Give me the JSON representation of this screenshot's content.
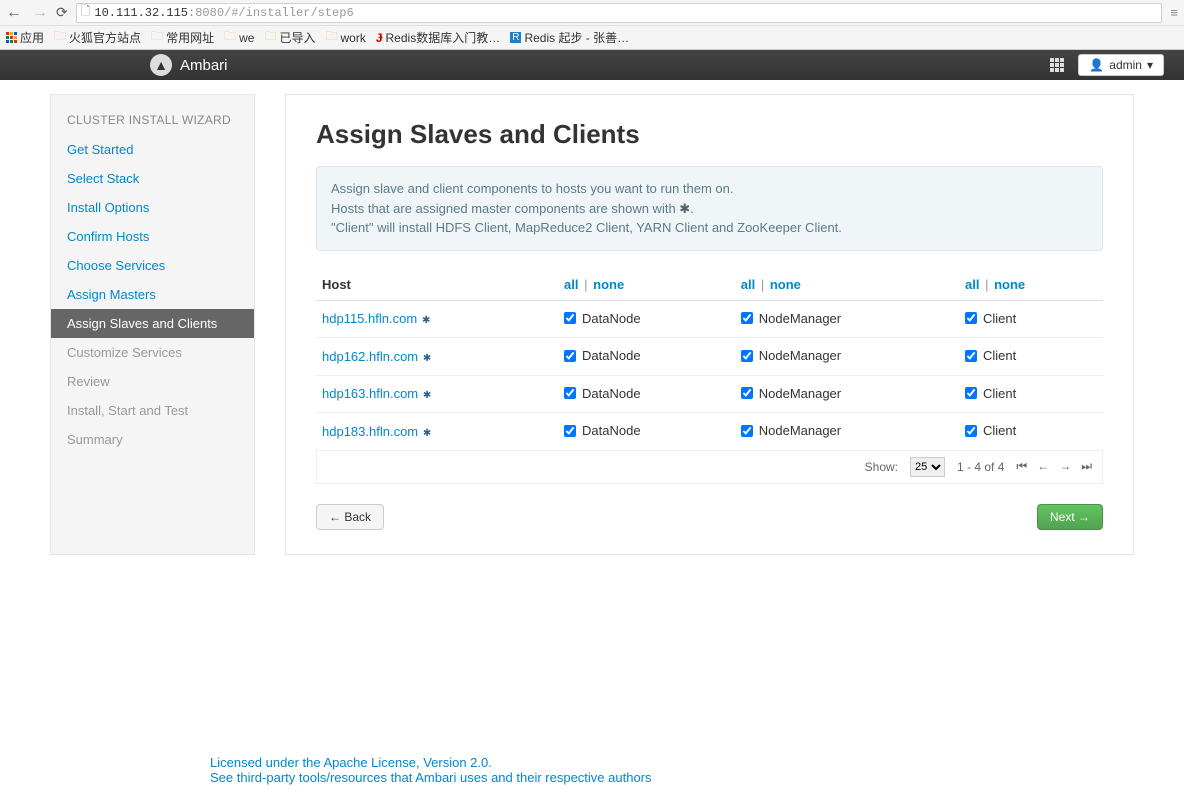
{
  "browser": {
    "url_host": "10.111.32.115",
    "url_port": ":8080",
    "url_path": "/#/installer/step6"
  },
  "bookmarks": {
    "apps": "应用",
    "items": [
      "火狐官方站点",
      "常用网址",
      "we",
      "已导入",
      "work",
      "Redis数据库入门教…",
      "Redis 起步 - 张善…"
    ]
  },
  "header": {
    "brand": "Ambari",
    "admin": "admin"
  },
  "wizard": {
    "title": "CLUSTER INSTALL WIZARD",
    "steps": [
      {
        "label": "Get Started",
        "state": "done"
      },
      {
        "label": "Select Stack",
        "state": "done"
      },
      {
        "label": "Install Options",
        "state": "done"
      },
      {
        "label": "Confirm Hosts",
        "state": "done"
      },
      {
        "label": "Choose Services",
        "state": "done"
      },
      {
        "label": "Assign Masters",
        "state": "done"
      },
      {
        "label": "Assign Slaves and Clients",
        "state": "active"
      },
      {
        "label": "Customize Services",
        "state": "future"
      },
      {
        "label": "Review",
        "state": "future"
      },
      {
        "label": "Install, Start and Test",
        "state": "future"
      },
      {
        "label": "Summary",
        "state": "future"
      }
    ]
  },
  "main": {
    "title": "Assign Slaves and Clients",
    "info_l1": "Assign slave and client components to hosts you want to run them on.",
    "info_l2a": "Hosts that are assigned master components are shown with ",
    "info_l2b": ".",
    "info_l3": "\"Client\" will install HDFS Client, MapReduce2 Client, YARN Client and ZooKeeper Client.",
    "columns": {
      "host": "Host",
      "all": "all",
      "none": "none"
    },
    "components": [
      "DataNode",
      "NodeManager",
      "Client"
    ],
    "hosts": [
      {
        "name": "hdp115.hfln.com",
        "master": true,
        "checks": [
          true,
          true,
          true
        ]
      },
      {
        "name": "hdp162.hfln.com",
        "master": true,
        "checks": [
          true,
          true,
          true
        ]
      },
      {
        "name": "hdp163.hfln.com",
        "master": true,
        "checks": [
          true,
          true,
          true
        ]
      },
      {
        "name": "hdp183.hfln.com",
        "master": true,
        "checks": [
          true,
          true,
          true
        ]
      }
    ],
    "pager": {
      "show_label": "Show:",
      "page_size": "25",
      "range": "1 - 4 of 4"
    },
    "back": "← Back",
    "next": "Next →"
  },
  "footer": {
    "license": "Licensed under the Apache License, Version 2.0.",
    "thirdparty": "See third-party tools/resources that Ambari uses and their respective authors"
  }
}
